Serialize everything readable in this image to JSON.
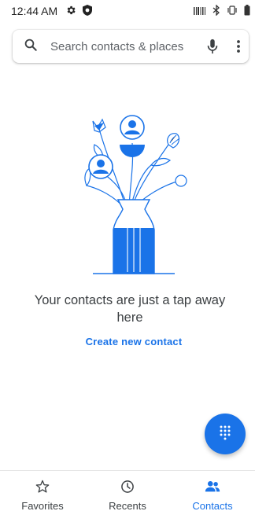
{
  "status_bar": {
    "time": "12:44 AM",
    "left_icons": [
      "gear-icon",
      "shield-icon"
    ],
    "right_icons": [
      "barcode-icon",
      "bluetooth-icon",
      "vibrate-icon",
      "battery-icon"
    ]
  },
  "search": {
    "placeholder": "Search contacts & places",
    "icons": [
      "search-icon",
      "mic-icon",
      "more-vert-icon"
    ]
  },
  "empty_state": {
    "message": "Your contacts are just a tap away here",
    "create_label": "Create new contact",
    "illustration": "vase-with-contact-flowers"
  },
  "fab": {
    "icon": "dialpad-icon"
  },
  "bottom_nav": {
    "items": [
      {
        "label": "Favorites",
        "icon": "star-icon",
        "active": false
      },
      {
        "label": "Recents",
        "icon": "clock-icon",
        "active": false
      },
      {
        "label": "Contacts",
        "icon": "people-icon",
        "active": true
      }
    ]
  },
  "colors": {
    "accent": "#1a73e8",
    "text": "#3c4043",
    "muted": "#5f6368"
  }
}
